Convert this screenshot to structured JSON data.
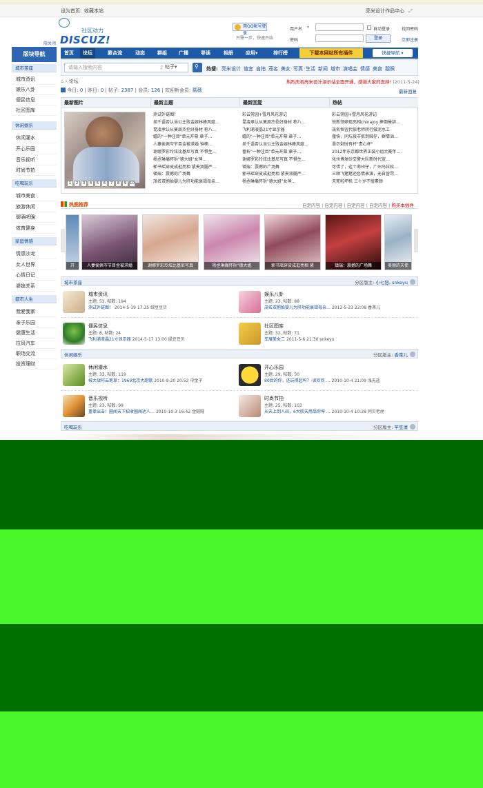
{
  "topbar": {
    "links": [
      "设为首页",
      "收藏本站"
    ],
    "right": "亮米设计作品中心"
  },
  "sidebar_close": "隐关闭",
  "logo": {
    "title": "社区动力",
    "brand": "DISCUZ!"
  },
  "qq": {
    "button": "用QQ帐号登录",
    "hint": "只需一步，快速开始"
  },
  "login": {
    "user_label": "用户名",
    "pass_label": "密码",
    "remember": "自动登录",
    "forgot": "找回密码",
    "submit": "登录",
    "register": "立即注册"
  },
  "sidebar": {
    "title": "版块导航",
    "groups": [
      {
        "name": "城市茶座",
        "items": [
          "城市资讯",
          "娱乐八卦",
          "便民信息",
          "社区图库"
        ]
      },
      {
        "name": "休闲娱乐",
        "items": [
          "休闲灌水",
          "开心乐园",
          "音乐视听",
          "时尚节拍"
        ]
      },
      {
        "name": "吃喝玩乐",
        "items": [
          "城市美食",
          "旅游休闲",
          "聊酒吧晚",
          "体育健身"
        ]
      },
      {
        "name": "家庭情感",
        "items": [
          "情感沙龙",
          "女人世界",
          "心情日记",
          "婆媳关系"
        ]
      },
      {
        "name": "都市人生",
        "items": [
          "我爱我家",
          "亲子乐园",
          "健康生活",
          "拉风汽车",
          "职场交流",
          "投资理财"
        ]
      }
    ]
  },
  "nav": {
    "items": [
      "首页",
      "论坛",
      "聚合流",
      "动态",
      "群组",
      "广播",
      "导读",
      "相册",
      "应用▾",
      "排行榜"
    ],
    "ad": "下载本网站所有插件",
    "quick": "快捷导航 ▾"
  },
  "search": {
    "placeholder": "请输入搜索内容",
    "scope": "帖子▾",
    "hot_label": "热搜:",
    "hot": [
      "亮米设计",
      "值宜",
      "自拍",
      "茂名",
      "美女",
      "写真",
      "生活",
      "新闻",
      "城市",
      "演唱会",
      "情感",
      "美食",
      "靓照"
    ]
  },
  "crumb": "论坛",
  "notice": {
    "text": "热烈庆祝亮米设计演示站全面开通，感谢大家的支持!",
    "date": "(2011-5-24)"
  },
  "stats": {
    "today_label": "今日:",
    "today": "0",
    "yesterday_label": "昨日:",
    "yesterday": "0",
    "posts_label": "帖子:",
    "posts": "2387",
    "members_label": "会员:",
    "members": "126",
    "newest_label": "欢迎新会员:",
    "newest": "蔷薇"
  },
  "newest_reply": "最新回复",
  "columns": [
    "最新图片",
    "最新主题",
    "最新回复",
    "热帖"
  ],
  "photo_pages": [
    "1",
    "2",
    "3",
    "4",
    "5",
    "6",
    "7",
    "8",
    "9",
    "10"
  ],
  "latest_topics": [
    "测试外链图！",
    "吴千语否认当公主败金娱林峰风度…",
    "昆凌承认从莫周杰伦好身材 称八…",
    "嬉的\"一种注目\"单元开幕 章子…",
    "人妻侯佩岑节目金被求婚 钟楠…",
    "谢娜罗彩玲炫比基尼写真 不惧生…",
    "杨丞琳痛怀拆\"德大姐\"女神…",
    "郭书瑶穿皮成逛亮相 紧夹双腿严…",
    "镇瑞：震撼的广场舞",
    "茂名双胞胎婴儿为肝功能衰竭母亲…"
  ],
  "latest_replies": [
    "彩云常园+雪月风花游记",
    "昆凌承认从莫周杰伦好身材 称八…",
    "飞利浦液晶21寸显示器",
    "嬉的\"一种注目\"单元开幕 章子…",
    "吴千语否认当公主败金娱林峰风度…",
    "蔷析\"一种注目\"单元开幕 章子…",
    "谢娜罗彩玲炫比基尼写真 不惧生…",
    "镇瑞：震撼的广场舞",
    "郭书瑶穿皮成逛亮相 紧夹双腿严…",
    "杨丞琳痛怀拆\"德大姐\"女神…"
  ],
  "hot_threads": [
    "彩云常园+雪月风花游记",
    "悦新领婷现亮相chinajoy 摔倒晕辞…",
    "茂名恒宜代侬老师转行做泥水工",
    "撞快，同坑夜市抓到贼仔，群情汹…",
    "滑尔剥时有杆\"贵心杯\"",
    "2012年东京都世界正装小组大赛年…",
    "化州博发砂交警大队新时代宣…",
    "可惜了，这个南州仔，广州马拉松…",
    "三顺飞猪猪还色情表演，无自营罚…",
    "天死啦坏机 三十岁不惶素颜"
  ],
  "hotrec": {
    "title": "热图推荐",
    "tabs": [
      "自定内容",
      "自定内容",
      "自定内容",
      "自定内容"
    ],
    "buy": "购买本插件"
  },
  "thumbs": [
    "开",
    "人妻侯佩岑节目金被求婚",
    "谢娜罗彩玲炫比基尼写真",
    "杨丞琳痛怀拆\"德大姐",
    "郭书瑶穿皮成逛亮相 紧",
    "镇瑞：震撼的广场舞",
    "美丽的天使"
  ],
  "sections": [
    {
      "title": "城市茶座",
      "mod_label": "分区版主:",
      "mods": "小七怒, snkeyu"
    },
    {
      "title": "休闲娱乐",
      "mod_label": "分区版主:",
      "mods": "香茶儿"
    },
    {
      "title": "吃喝玩乐",
      "mod_label": "分区版主:",
      "mods": "竿笠清"
    }
  ],
  "forums": [
    {
      "name": "城市资讯",
      "stats": "主题: 53, 帖数: 194",
      "last": "测试外链图！",
      "meta": "2014-5-19 17:35 绿豆豆贝"
    },
    {
      "name": "娱乐八卦",
      "stats": "主题: 23, 帖数: 88",
      "last": "茂名双胞胎婴儿为肝功能衰竭母亲…",
      "meta": "2013-5-23 22:08 香茶儿"
    },
    {
      "name": "便民信息",
      "stats": "主题: 8, 帖数: 24",
      "last": "飞利浦液晶21寸显示器",
      "meta": "2014-5-17 13:00 绿豆豆贝"
    },
    {
      "name": "社区图库",
      "stats": "主题: 32, 帖数: 71",
      "last": "车展美女二",
      "meta": "2011-5-6 21:30 snkeyu"
    },
    {
      "name": "休闲灌水",
      "stats": "主题: 33, 帖数: 119",
      "last": "械大战阿云笔草：1969北京大跑歌",
      "meta": "2010-9-20 20:52 中金子"
    },
    {
      "name": "开心乐园",
      "stats": "主题: 29, 帖数: 30",
      "last": "80后的你，还玩得起吗？-读欢欢 …",
      "meta": "2010-10-4 21:09 浅无盐"
    },
    {
      "name": "音乐视听",
      "stats": "主题: 23, 帖数: 99",
      "last": "重拳出击！圈闻天下招收圈闻达人…",
      "meta": "2010-10-3 16:42 金隧隧"
    },
    {
      "name": "时尚节拍",
      "stats": "主题: 25, 帖数: 103",
      "last": "从天上到人间，6大航天用品你坤 …",
      "meta": "2010-10-4 10:28 同贝老虎"
    }
  ],
  "colors": {
    "nav": "#1d5aa8",
    "accent": "#2f66b3",
    "ad": "#f2cf38",
    "green_dark": "#006a00",
    "green_light": "#4af82a"
  }
}
